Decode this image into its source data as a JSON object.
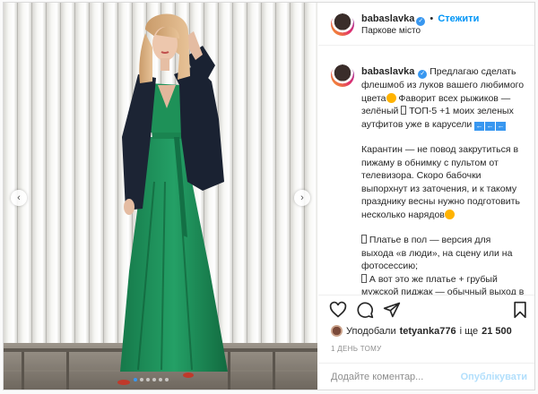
{
  "header": {
    "username": "babaslavka",
    "separator": "•",
    "follow_label": "Стежити",
    "location": "Паркове місто",
    "more_icon": "more-dots-icon"
  },
  "caption": {
    "username": "babaslavka",
    "p1_a": "Предлагаю сделать флешмоб из луков вашего любимого цвета",
    "p1_b": " Фаворит всех рыжиков — зелёный ",
    "p1_c": " ТОП-5 +1 моих зеленых аутфитов уже в карусели ",
    "arrow": "←",
    "p2": "Карантин — не повод закрутиться в пижаму в обнимку с пультом от телевизора. Скоро бабочки выпорхнут из заточения, и к такому празднику весны нужно подготовить несколько нарядов",
    "p3_a": " Платье в пол — версия для выхода «в люди», на сцену или на фотосессию;",
    "p3_b": " А вот это же платье + грубый мужской пиджак — обычный выход в ресторан"
  },
  "likes": {
    "prefix": "Уподобали",
    "user": "tetyanka776",
    "joiner": "і ще",
    "count": "21 500"
  },
  "time": "1 ДЕНЬ ТОМУ",
  "comment": {
    "placeholder": "Додайте коментар...",
    "publish_label": "Опублікувати"
  },
  "carousel": {
    "prev": "‹",
    "next": "›",
    "slides": 6,
    "active": 1
  },
  "colors": {
    "accent": "#0095f6",
    "verified": "#3897f0",
    "dress": "#1f8a55",
    "jacket": "#1b2333"
  }
}
